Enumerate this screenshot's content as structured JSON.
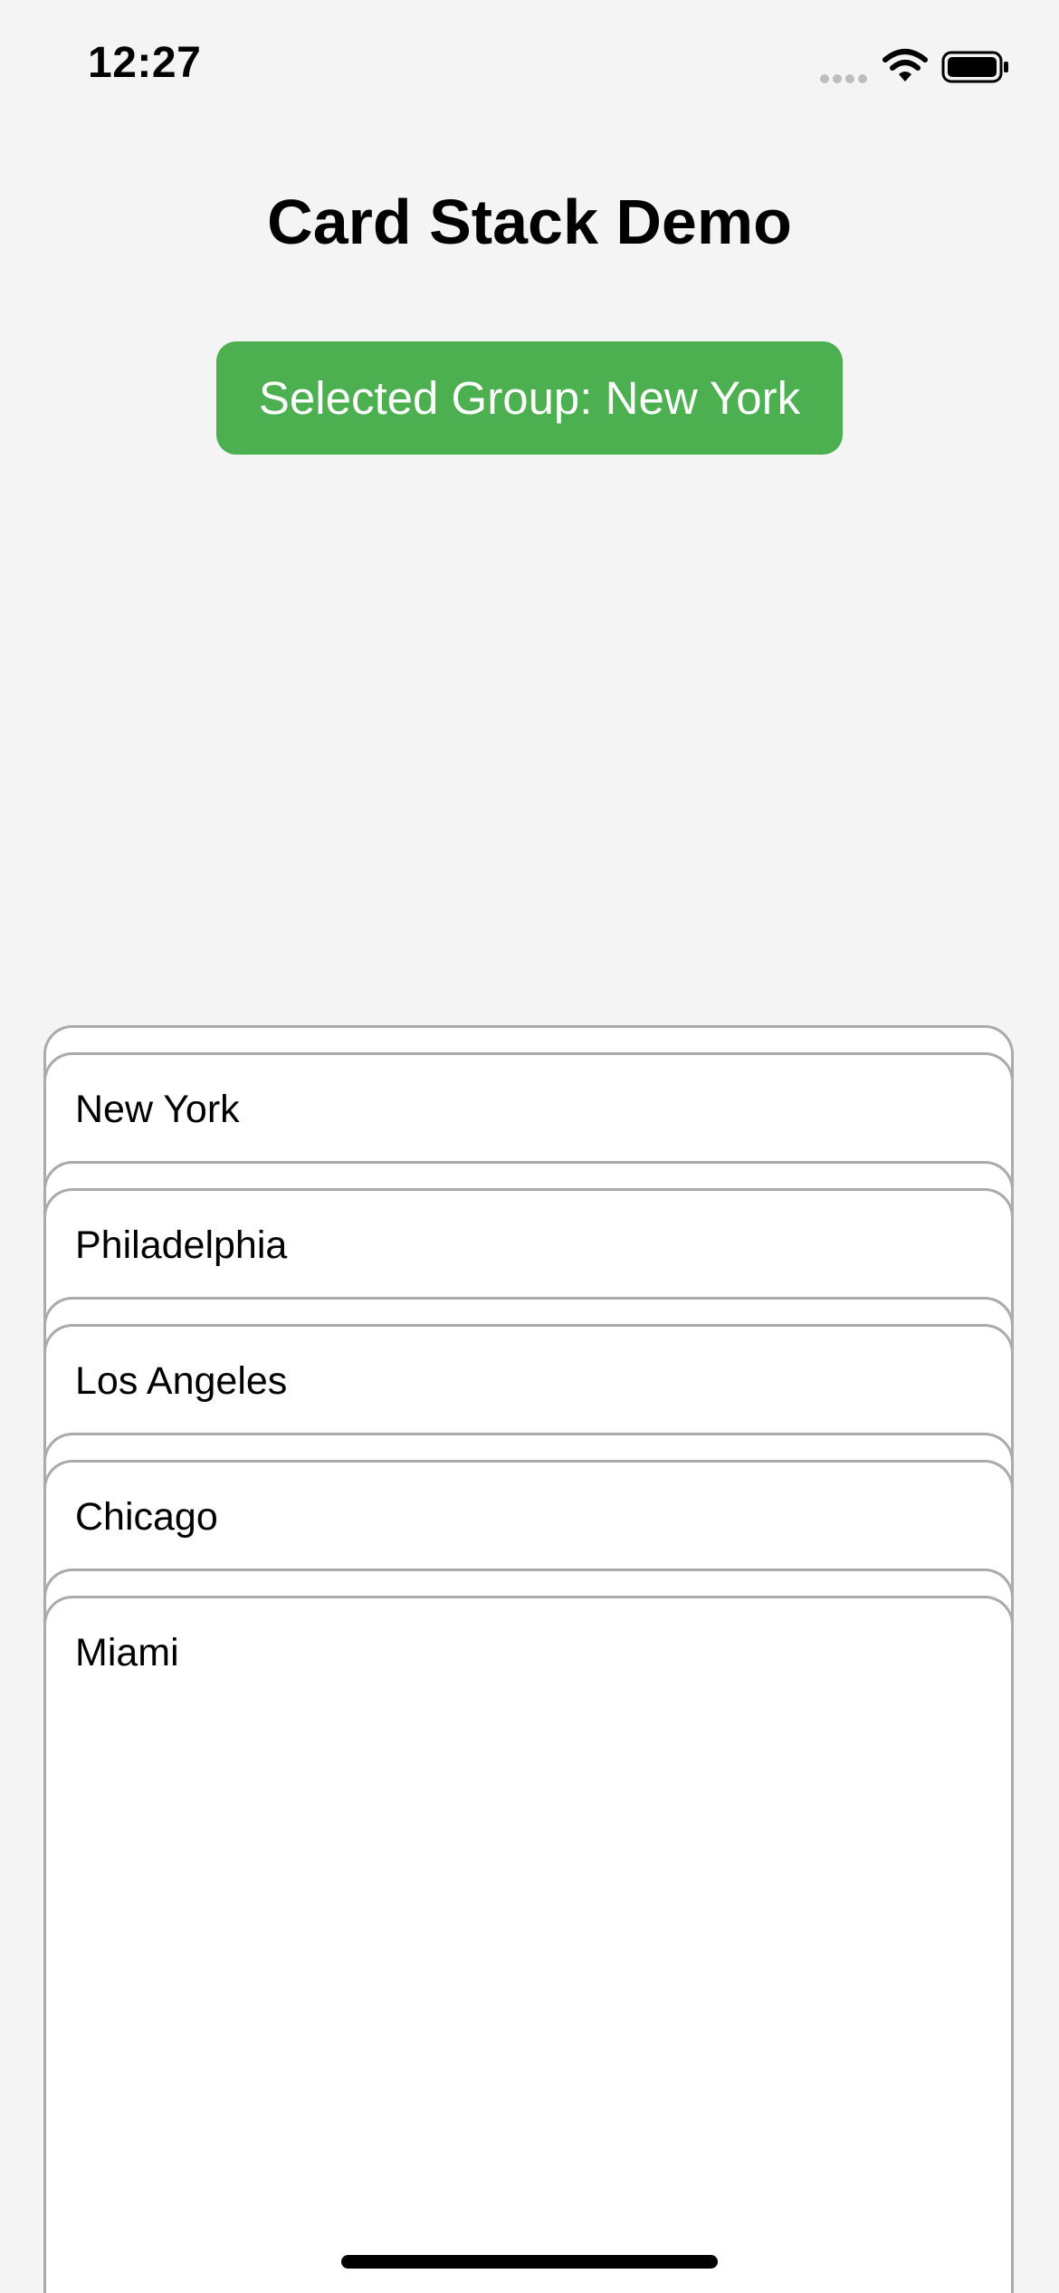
{
  "status_bar": {
    "time": "12:27",
    "icons": [
      "signal-dots-icon",
      "wifi-icon",
      "battery-icon"
    ]
  },
  "header": {
    "title": "Card Stack Demo"
  },
  "selected_group_button": {
    "label": "Selected Group: New York",
    "color": "#4caf50"
  },
  "cards": [
    {
      "label": "New York"
    },
    {
      "label": "Philadelphia"
    },
    {
      "label": "Los Angeles"
    },
    {
      "label": "Chicago"
    },
    {
      "label": "Miami"
    }
  ],
  "colors": {
    "background": "#f4f4f4",
    "card_border": "#aaaaaa",
    "card_fill": "#ffffff"
  }
}
